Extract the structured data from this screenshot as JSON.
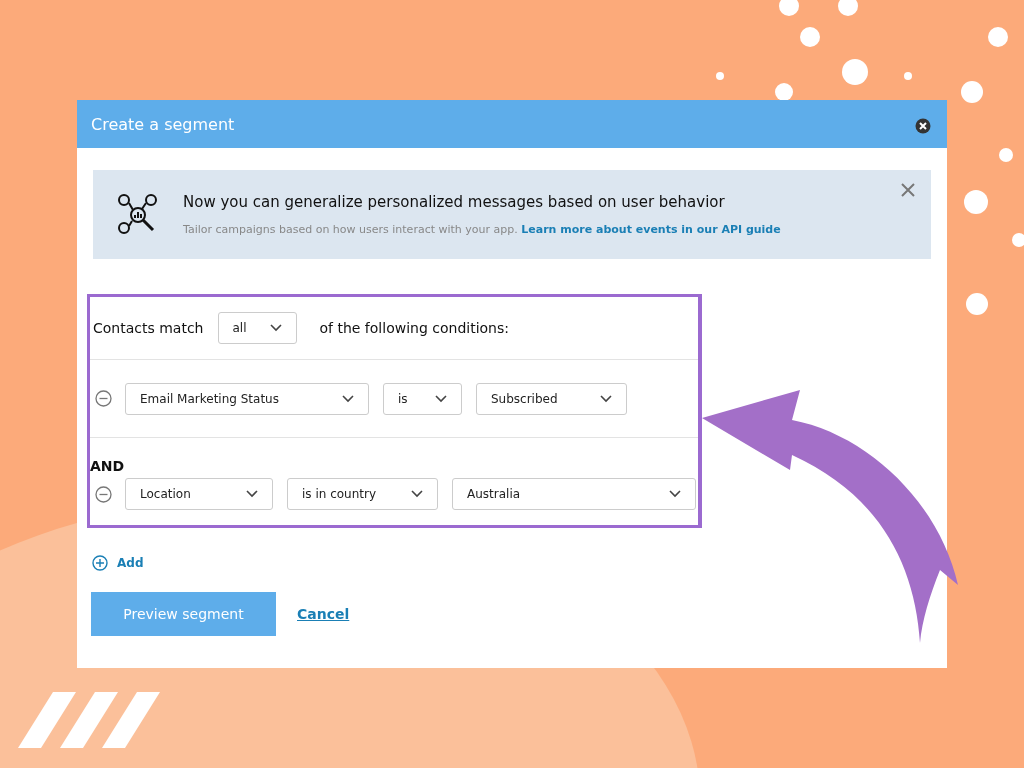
{
  "dialog": {
    "title": "Create a segment"
  },
  "banner": {
    "heading": "Now you can generalize personalized messages based on user behavior",
    "text": "Tailor campaigns based on how users interact with your app.",
    "link": "Learn more about events in our API guide"
  },
  "match": {
    "label": "Contacts match",
    "value": "all",
    "suffix": "of the following conditions:"
  },
  "conditions": [
    {
      "fields": [
        "Email Marketing Status",
        "is",
        "Subscribed"
      ]
    },
    {
      "joiner": "AND",
      "fields": [
        "Location",
        "is in country",
        "Australia"
      ]
    }
  ],
  "add_label": "Add",
  "buttons": {
    "primary": "Preview segment",
    "cancel": "Cancel"
  }
}
